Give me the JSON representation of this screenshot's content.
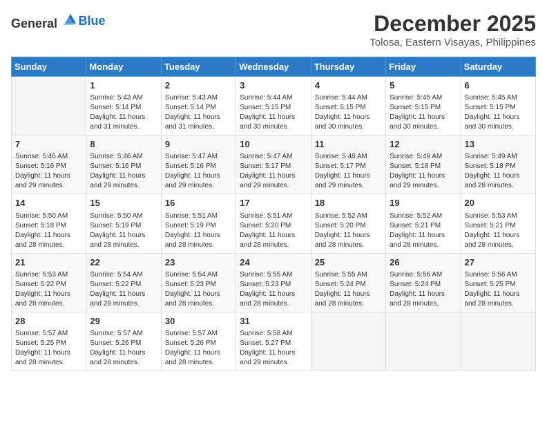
{
  "header": {
    "logo_general": "General",
    "logo_blue": "Blue",
    "month": "December 2025",
    "location": "Tolosa, Eastern Visayas, Philippines"
  },
  "weekdays": [
    "Sunday",
    "Monday",
    "Tuesday",
    "Wednesday",
    "Thursday",
    "Friday",
    "Saturday"
  ],
  "weeks": [
    [
      {
        "day": "",
        "info": ""
      },
      {
        "day": "1",
        "info": "Sunrise: 5:43 AM\nSunset: 5:14 PM\nDaylight: 11 hours\nand 31 minutes."
      },
      {
        "day": "2",
        "info": "Sunrise: 5:43 AM\nSunset: 5:14 PM\nDaylight: 11 hours\nand 31 minutes."
      },
      {
        "day": "3",
        "info": "Sunrise: 5:44 AM\nSunset: 5:15 PM\nDaylight: 11 hours\nand 30 minutes."
      },
      {
        "day": "4",
        "info": "Sunrise: 5:44 AM\nSunset: 5:15 PM\nDaylight: 11 hours\nand 30 minutes."
      },
      {
        "day": "5",
        "info": "Sunrise: 5:45 AM\nSunset: 5:15 PM\nDaylight: 11 hours\nand 30 minutes."
      },
      {
        "day": "6",
        "info": "Sunrise: 5:45 AM\nSunset: 5:15 PM\nDaylight: 11 hours\nand 30 minutes."
      }
    ],
    [
      {
        "day": "7",
        "info": "Sunrise: 5:46 AM\nSunset: 5:16 PM\nDaylight: 11 hours\nand 29 minutes."
      },
      {
        "day": "8",
        "info": "Sunrise: 5:46 AM\nSunset: 5:16 PM\nDaylight: 11 hours\nand 29 minutes."
      },
      {
        "day": "9",
        "info": "Sunrise: 5:47 AM\nSunset: 5:16 PM\nDaylight: 11 hours\nand 29 minutes."
      },
      {
        "day": "10",
        "info": "Sunrise: 5:47 AM\nSunset: 5:17 PM\nDaylight: 11 hours\nand 29 minutes."
      },
      {
        "day": "11",
        "info": "Sunrise: 5:48 AM\nSunset: 5:17 PM\nDaylight: 11 hours\nand 29 minutes."
      },
      {
        "day": "12",
        "info": "Sunrise: 5:49 AM\nSunset: 5:18 PM\nDaylight: 11 hours\nand 29 minutes."
      },
      {
        "day": "13",
        "info": "Sunrise: 5:49 AM\nSunset: 5:18 PM\nDaylight: 11 hours\nand 28 minutes."
      }
    ],
    [
      {
        "day": "14",
        "info": "Sunrise: 5:50 AM\nSunset: 5:18 PM\nDaylight: 11 hours\nand 28 minutes."
      },
      {
        "day": "15",
        "info": "Sunrise: 5:50 AM\nSunset: 5:19 PM\nDaylight: 11 hours\nand 28 minutes."
      },
      {
        "day": "16",
        "info": "Sunrise: 5:51 AM\nSunset: 5:19 PM\nDaylight: 11 hours\nand 28 minutes."
      },
      {
        "day": "17",
        "info": "Sunrise: 5:51 AM\nSunset: 5:20 PM\nDaylight: 11 hours\nand 28 minutes."
      },
      {
        "day": "18",
        "info": "Sunrise: 5:52 AM\nSunset: 5:20 PM\nDaylight: 11 hours\nand 28 minutes."
      },
      {
        "day": "19",
        "info": "Sunrise: 5:52 AM\nSunset: 5:21 PM\nDaylight: 11 hours\nand 28 minutes."
      },
      {
        "day": "20",
        "info": "Sunrise: 5:53 AM\nSunset: 5:21 PM\nDaylight: 11 hours\nand 28 minutes."
      }
    ],
    [
      {
        "day": "21",
        "info": "Sunrise: 5:53 AM\nSunset: 5:22 PM\nDaylight: 11 hours\nand 28 minutes."
      },
      {
        "day": "22",
        "info": "Sunrise: 5:54 AM\nSunset: 5:22 PM\nDaylight: 11 hours\nand 28 minutes."
      },
      {
        "day": "23",
        "info": "Sunrise: 5:54 AM\nSunset: 5:23 PM\nDaylight: 11 hours\nand 28 minutes."
      },
      {
        "day": "24",
        "info": "Sunrise: 5:55 AM\nSunset: 5:23 PM\nDaylight: 11 hours\nand 28 minutes."
      },
      {
        "day": "25",
        "info": "Sunrise: 5:55 AM\nSunset: 5:24 PM\nDaylight: 11 hours\nand 28 minutes."
      },
      {
        "day": "26",
        "info": "Sunrise: 5:56 AM\nSunset: 5:24 PM\nDaylight: 11 hours\nand 28 minutes."
      },
      {
        "day": "27",
        "info": "Sunrise: 5:56 AM\nSunset: 5:25 PM\nDaylight: 11 hours\nand 28 minutes."
      }
    ],
    [
      {
        "day": "28",
        "info": "Sunrise: 5:57 AM\nSunset: 5:25 PM\nDaylight: 11 hours\nand 28 minutes."
      },
      {
        "day": "29",
        "info": "Sunrise: 5:57 AM\nSunset: 5:26 PM\nDaylight: 11 hours\nand 28 minutes."
      },
      {
        "day": "30",
        "info": "Sunrise: 5:57 AM\nSunset: 5:26 PM\nDaylight: 11 hours\nand 28 minutes."
      },
      {
        "day": "31",
        "info": "Sunrise: 5:58 AM\nSunset: 5:27 PM\nDaylight: 11 hours\nand 29 minutes."
      },
      {
        "day": "",
        "info": ""
      },
      {
        "day": "",
        "info": ""
      },
      {
        "day": "",
        "info": ""
      }
    ]
  ]
}
